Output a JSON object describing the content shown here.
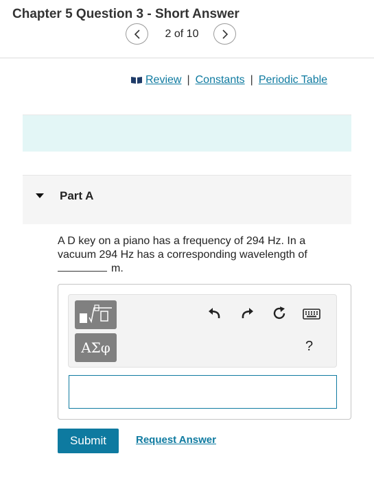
{
  "header": {
    "title": "Chapter 5 Question 3 - Short Answer",
    "pager": {
      "count": "2 of 10",
      "prev_icon": "chevron-left-icon",
      "next_icon": "chevron-right-icon"
    }
  },
  "links": {
    "review": "Review",
    "separator": "|",
    "constants": "Constants",
    "periodic_table": "Periodic Table",
    "link_color": "#0e7aa0",
    "icon": "book-icon"
  },
  "part": {
    "title": "Part A"
  },
  "question": {
    "text": "A D key on a piano has a frequency of 294 Hz. In a vacuum 294 Hz has a corresponding wavelength of",
    "unit": "m."
  },
  "toolbar": {
    "templates_icon": "templates-icon",
    "symbols_label": "ΑΣφ",
    "undo_icon": "undo-icon",
    "redo_icon": "redo-icon",
    "reset_icon": "reset-icon",
    "keyboard_icon": "keyboard-icon",
    "help_label": "?"
  },
  "answer": {
    "value": "",
    "placeholder": ""
  },
  "actions": {
    "submit_label": "Submit",
    "request_label": "Request Answer",
    "accent": "#0e7aa0"
  }
}
